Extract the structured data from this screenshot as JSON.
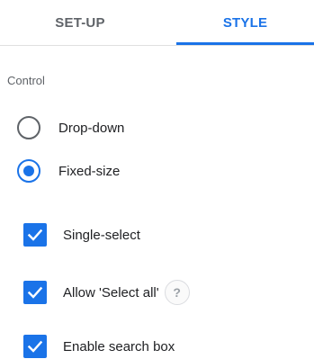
{
  "tabs": {
    "setup_label": "SET-UP",
    "style_label": "STYLE",
    "active": "STYLE"
  },
  "control": {
    "section_label": "Control",
    "radios": [
      {
        "label": "Drop-down",
        "checked": false
      },
      {
        "label": "Fixed-size",
        "checked": true
      }
    ],
    "checkboxes": [
      {
        "label": "Single-select",
        "checked": true
      },
      {
        "label": "Allow 'Select all'",
        "checked": true,
        "has_help": true
      },
      {
        "label": "Enable search box",
        "checked": true
      }
    ],
    "help_glyph": "?"
  },
  "colors": {
    "accent": "#1a73e8",
    "inactive_tab": "#5f6368",
    "text": "#202124",
    "help": "#9aa0a6"
  },
  "icons": {
    "checkbox": "check-icon",
    "help": "help-icon"
  }
}
